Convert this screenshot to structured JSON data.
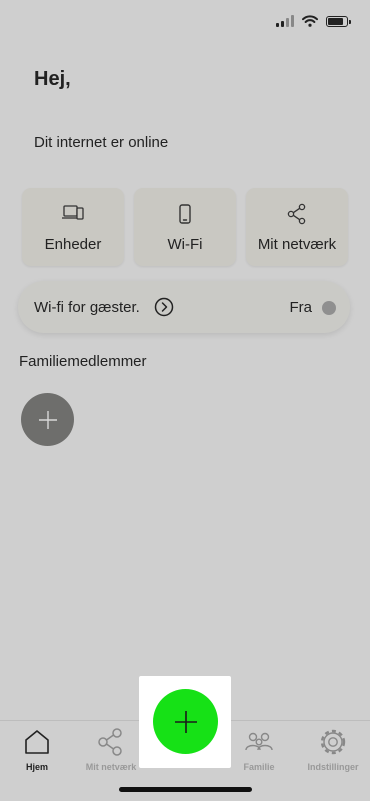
{
  "greeting": "Hej,",
  "status_text": "Dit internet er online",
  "tiles": [
    {
      "label": "Enheder",
      "icon": "devices-icon"
    },
    {
      "label": "Wi-Fi",
      "icon": "phone-icon"
    },
    {
      "label": "Mit netværk",
      "icon": "share-network-icon"
    }
  ],
  "guest_wifi": {
    "label": "Wi-fi for gæster.",
    "state": "Fra",
    "enabled": false
  },
  "family": {
    "heading": "Familiemedlemmer"
  },
  "tabs": [
    {
      "label": "Hjem",
      "icon": "home-icon",
      "active": true
    },
    {
      "label": "Mit netværk",
      "icon": "share-network-icon",
      "active": false
    },
    {
      "label": "Familie",
      "icon": "family-icon",
      "active": false
    },
    {
      "label": "Indstillinger",
      "icon": "gear-icon",
      "active": false
    }
  ],
  "colors": {
    "fab": "#16e116",
    "background": "#cfcfcf",
    "tile": "#c9c8c2"
  }
}
